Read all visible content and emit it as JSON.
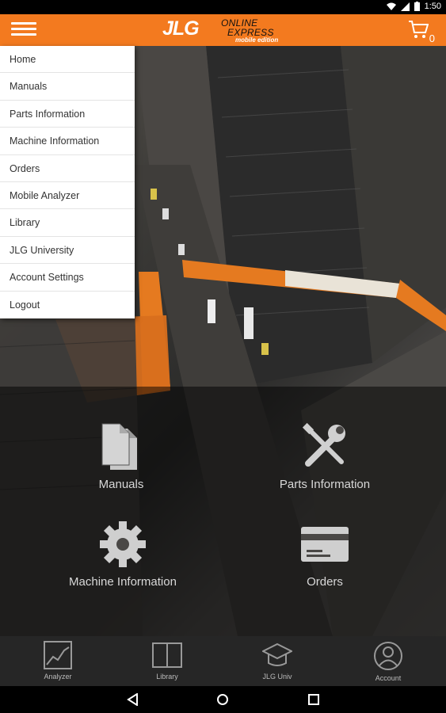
{
  "status_bar": {
    "time": "1:50"
  },
  "app_bar": {
    "logo_brand": "JLG",
    "logo_line1": "ONLINE",
    "logo_line2": "EXPRESS",
    "logo_line3": "mobile edition",
    "cart_count": "0"
  },
  "drawer": {
    "items": [
      {
        "label": "Home"
      },
      {
        "label": "Manuals"
      },
      {
        "label": "Parts Information"
      },
      {
        "label": "Machine Information"
      },
      {
        "label": "Orders"
      },
      {
        "label": "Mobile Analyzer"
      },
      {
        "label": "Library"
      },
      {
        "label": "JLG University"
      },
      {
        "label": "Account Settings"
      },
      {
        "label": "Logout"
      }
    ]
  },
  "tiles": {
    "manuals": "Manuals",
    "parts": "Parts Information",
    "machine": "Machine Information",
    "orders": "Orders"
  },
  "bottom_nav": {
    "analyzer": "Analyzer",
    "library": "Library",
    "univ": "JLG Univ",
    "account": "Account"
  },
  "colors": {
    "brand_orange": "#f37a1f",
    "nav_bg": "#262626"
  }
}
